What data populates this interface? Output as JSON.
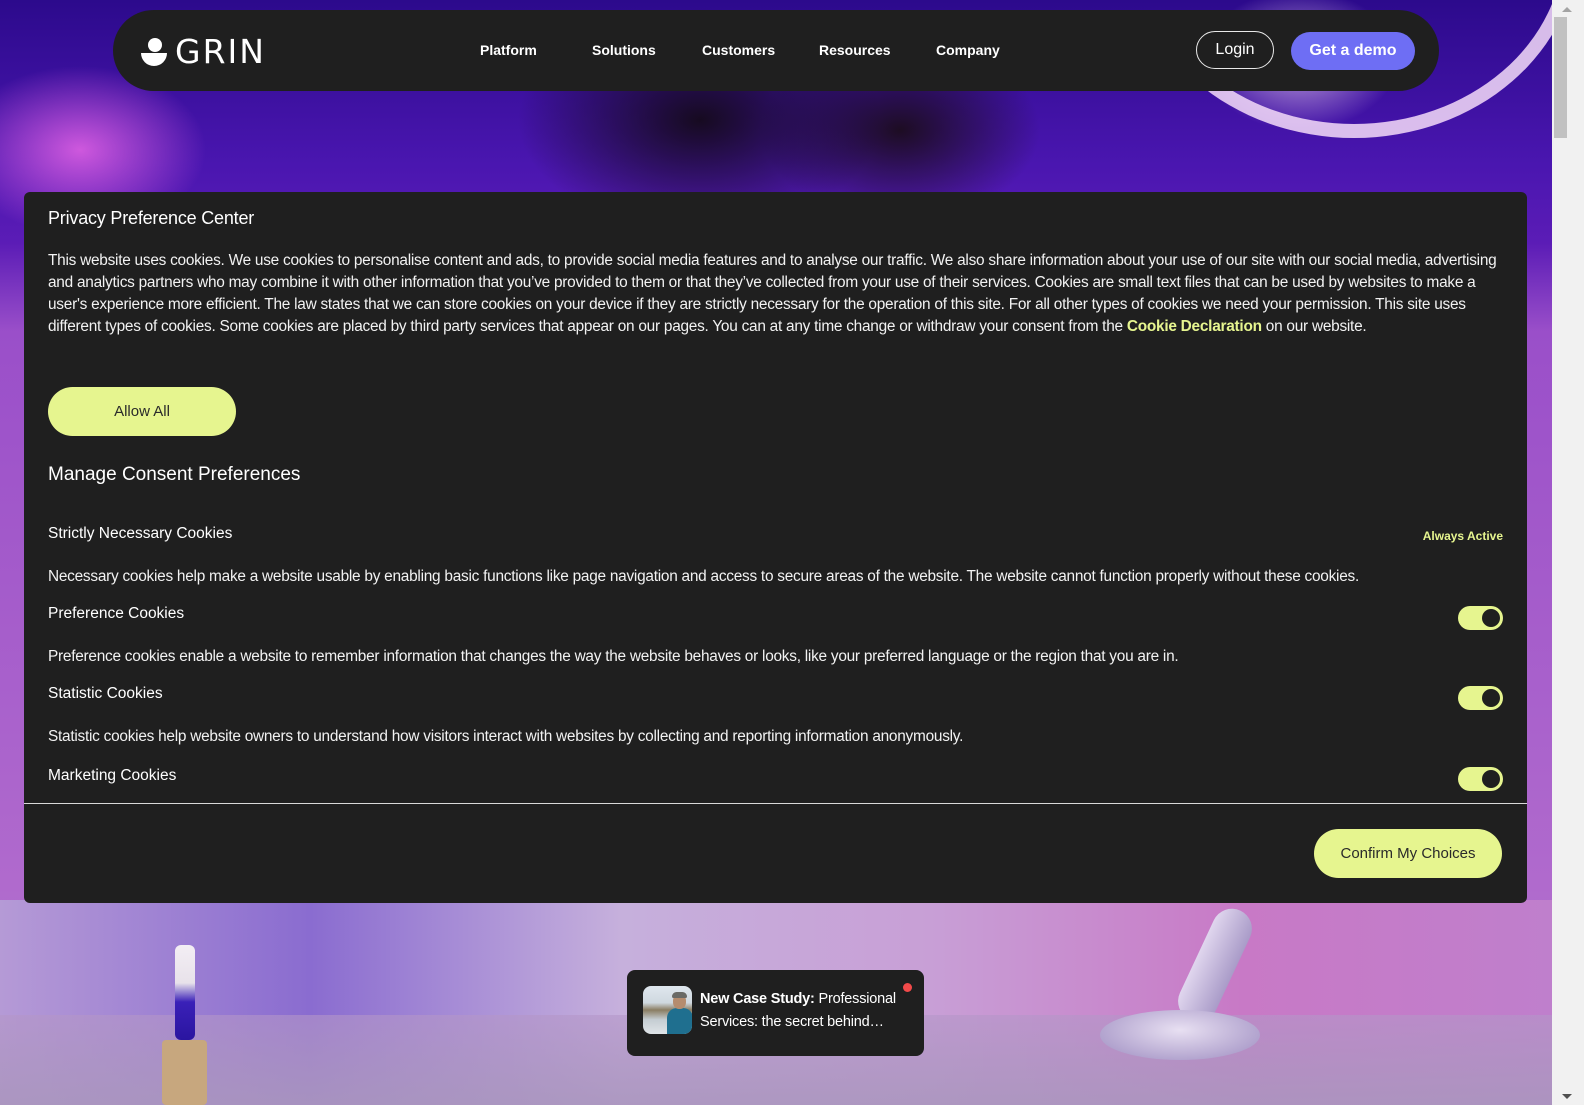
{
  "nav": {
    "logo_text": "GRIN",
    "links": [
      "Platform",
      "Solutions",
      "Customers",
      "Resources",
      "Company"
    ],
    "login_label": "Login",
    "demo_label": "Get a demo",
    "demo_color": "#6e6ef4"
  },
  "consent": {
    "title": "Privacy Preference Center",
    "intro_text": "This website uses cookies. We use cookies to personalise content and ads, to provide social media features and to analyse our traffic. We also share information about your use of our site with our social media, advertising and analytics partners who may combine it with other information that you’ve provided to them or that they’ve collected from your use of their services. Cookies are small text files that can be used by websites to make a user's experience more efficient. The law states that we can store cookies on your device if they are strictly necessary for the operation of this site. For all other types of cookies we need your permission. This site uses different types of cookies. Some cookies are placed by third party services that appear on our pages. You can at any time change or withdraw your consent from the ",
    "intro_link": "Cookie Declaration",
    "intro_suffix": " on our website.",
    "allow_all_label": "Allow All",
    "manage_title": "Manage Consent Preferences",
    "accent_color": "#e6f58f",
    "categories": [
      {
        "title": "Strictly Necessary Cookies",
        "status": "Always Active",
        "description": "Necessary cookies help make a website usable by enabling basic functions like page navigation and access to secure areas of the website. The website cannot function properly without these cookies."
      },
      {
        "title": "Preference Cookies",
        "enabled": true,
        "description": "Preference cookies enable a website to remember information that changes the way the website behaves or looks, like your preferred language or the region that you are in."
      },
      {
        "title": "Statistic Cookies",
        "enabled": true,
        "description": "Statistic cookies help website owners to understand how visitors interact with websites by collecting and reporting information anonymously."
      },
      {
        "title": "Marketing Cookies",
        "enabled": true
      }
    ],
    "confirm_label": "Confirm My Choices"
  },
  "toast": {
    "bold_label": "New Case Study:",
    "text": " Professional Services: the secret behind…"
  }
}
